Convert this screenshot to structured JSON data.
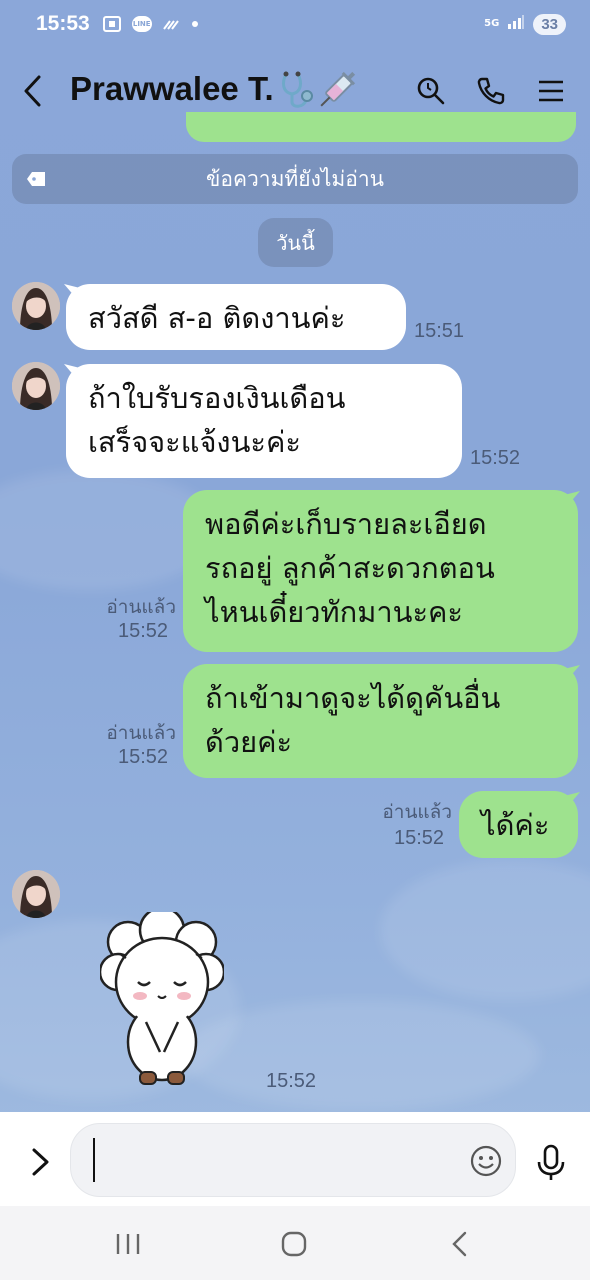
{
  "status_bar": {
    "time": "15:53",
    "network": "5G",
    "battery": "33",
    "line_badge": "LINE"
  },
  "header": {
    "contact_name": "Prawwalee T.",
    "title_icons": [
      "stethoscope-icon",
      "syringe-icon"
    ],
    "actions": [
      "search-icon",
      "phone-icon",
      "menu-icon"
    ]
  },
  "unread_banner": {
    "text": "ข้อความที่ยังไม่อ่าน"
  },
  "date_divider": {
    "text": "วันนี้"
  },
  "messages": [
    {
      "direction": "in",
      "lines": [
        "สวัสดี ส-อ ติดงานค่ะ"
      ],
      "time": "15:51"
    },
    {
      "direction": "in",
      "lines": [
        "ถ้าใบรับรองเงินเดือน",
        "เสร็จจะแจ้งนะค่ะ"
      ],
      "time": "15:52"
    },
    {
      "direction": "out",
      "lines": [
        "พอดีค่ะเก็บรายละเอียด",
        "รถอยู่ ลูกค้าสะดวกตอน",
        "ไหนเดี๋ยวทักมานะคะ"
      ],
      "read": "อ่านแล้ว",
      "time": "15:52"
    },
    {
      "direction": "out",
      "lines": [
        "ถ้าเข้ามาดูจะได้ดูคันอื่น",
        "ด้วยค่ะ"
      ],
      "read": "อ่านแล้ว",
      "time": "15:52"
    },
    {
      "direction": "out",
      "lines": [
        "ได้ค่ะ"
      ],
      "read": "อ่านแล้ว",
      "time": "15:52"
    },
    {
      "direction": "in",
      "type": "sticker",
      "sticker": "white-lamb-bow-sticker",
      "time": "15:52"
    }
  ],
  "input_bar": {
    "value": "",
    "placeholder": ""
  },
  "colors": {
    "background": "#8aa6d6",
    "bubble_in": "#ffffff",
    "bubble_out": "#9ee28e",
    "input_bar": "#ffffff",
    "nav_bar": "#f4f4f6"
  }
}
